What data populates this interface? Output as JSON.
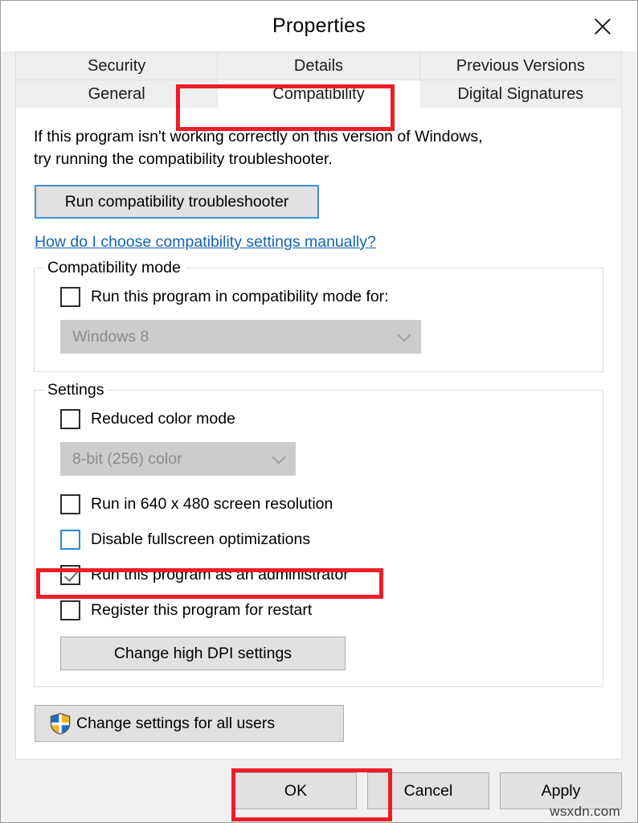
{
  "window": {
    "title": "Properties",
    "close_icon": "close-icon"
  },
  "tabs": {
    "row1": [
      {
        "label": "Security",
        "active": false
      },
      {
        "label": "Details",
        "active": false
      },
      {
        "label": "Previous Versions",
        "active": false
      }
    ],
    "row2": [
      {
        "label": "General",
        "active": false
      },
      {
        "label": "Compatibility",
        "active": true
      },
      {
        "label": "Digital Signatures",
        "active": false
      }
    ]
  },
  "content": {
    "intro_line1": "If this program isn't working correctly on this version of Windows,",
    "intro_line2": "try running the compatibility troubleshooter.",
    "troubleshoot_button": "Run compatibility troubleshooter",
    "help_link": "How do I choose compatibility settings manually? "
  },
  "compatibility_mode": {
    "group_title": "Compatibility mode",
    "checkbox_label": "Run this program in compatibility mode for:",
    "checkbox_checked": false,
    "dropdown_value": "Windows 8",
    "dropdown_disabled": true
  },
  "settings": {
    "group_title": "Settings",
    "reduced_color_label": "Reduced color mode",
    "reduced_color_checked": false,
    "color_depth_value": "8-bit (256) color",
    "color_depth_disabled": true,
    "items": [
      {
        "label": "Run in 640 x 480 screen resolution",
        "checked": false,
        "hover": false
      },
      {
        "label": "Disable fullscreen optimizations",
        "checked": false,
        "hover": true
      },
      {
        "label": "Run this program as an administrator",
        "checked": true,
        "hover": false
      },
      {
        "label": "Register this program for restart",
        "checked": false,
        "hover": false
      }
    ],
    "dpi_button": "Change high DPI settings"
  },
  "all_users_button": {
    "label": "Change settings for all users",
    "icon": "uac-shield-icon"
  },
  "footer": {
    "ok": "OK",
    "cancel": "Cancel",
    "apply": "Apply"
  },
  "watermark": "wsxdn.com",
  "annotations": {
    "accent_color": "#ee1c25",
    "targets": [
      "Compatibility tab",
      "Run this program as an administrator",
      "OK button"
    ]
  },
  "colors": {
    "link": "#1464b4",
    "focus_border": "#3f8fd2",
    "button_face": "#e1e1e1",
    "disabled_field": "#cccccc",
    "shield_blue": "#1d6fc0",
    "shield_yellow": "#f5b321"
  }
}
